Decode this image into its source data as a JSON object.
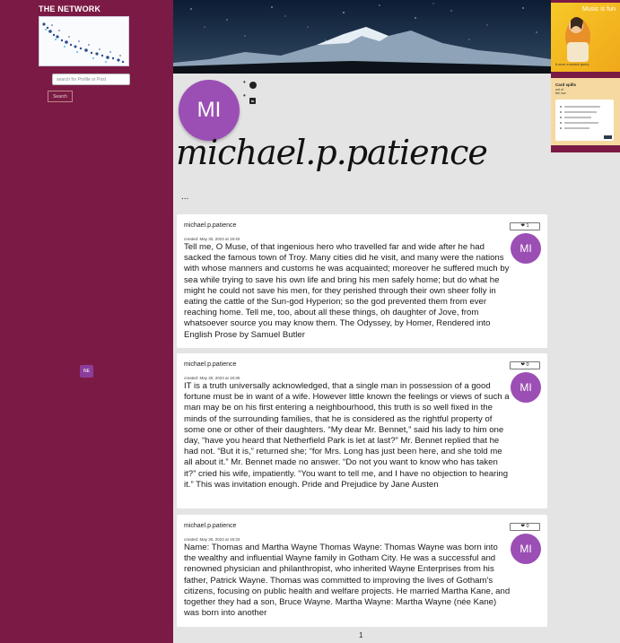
{
  "sidebar": {
    "brand": "THE NETWORK",
    "search_placeholder": "search for Profile or Post",
    "search_button": "Search",
    "badge": "NE"
  },
  "profile": {
    "initials": "MI",
    "username": "michael.p.patience",
    "bio": "...",
    "social": [
      {
        "icon": "github-icon"
      },
      {
        "icon": "linkedin-icon"
      }
    ]
  },
  "posts": [
    {
      "author": "michael.p.patience",
      "created": "created: May 30, 2023 at 19:40",
      "body": "Tell me, O Muse, of that ingenious hero who travelled far and wide after he had sacked the famous town of Troy. Many cities did he visit, and many were the nations with whose manners and customs he was acquainted; moreover he suffered much by sea while trying to save his own life and bring his men safely home; but do what he might he could not save his men, for they perished through their own sheer folly in eating the cattle of the Sun-god Hyperion; so the god prevented them from ever reaching home. Tell me, too, about all these things, oh daughter of Jove, from whatsoever source you may know them. The Odyssey, by Homer, Rendered into English Prose by Samuel Butler",
      "likes": "❤ 1",
      "initials": "MI"
    },
    {
      "author": "michael.p.patience",
      "created": "created: May 30, 2023 at 19:36",
      "body": "IT is a truth universally acknowledged, that a single man in possession of a good fortune must be in want of a wife. However little known the feelings or views of such a man may be on his first entering a neighbourhood, this truth is so well fixed in the minds of the surrounding families, that he is considered as the rightful property of some one or other of their daughters. “My dear Mr. Bennet,” said his lady to him one day, “have you heard that Netherfield Park is let at last?” Mr. Bennet replied that he had not. “But it is,” returned she; “for Mrs. Long has just been here, and she told me all about it.” Mr. Bennet made no answer. “Do not you want to know who has taken it?” cried his wife, impatiently. “You want to tell me, and I have no objection to hearing it.” This was invitation enough. Pride and Prejudice by Jane Austen",
      "likes": "❤ 0",
      "initials": "MI"
    },
    {
      "author": "michael.p.patience",
      "created": "created: May 30, 2023 at 19:33",
      "body": "Name: Thomas and Martha Wayne Thomas Wayne: Thomas Wayne was born into the wealthy and influential Wayne family in Gotham City. He was a successful and renowned physician and philanthropist, who inherited Wayne Enterprises from his father, Patrick Wayne. Thomas was committed to improving the lives of Gotham's citizens, focusing on public health and welfare projects. He married Martha Kane, and together they had a son, Bruce Wayne. Martha Wayne: Martha Wayne (née Kane) was born into another",
      "likes": "❤ 0",
      "initials": "MI"
    }
  ],
  "pagination": {
    "current": "1"
  },
  "ads": {
    "ad1_title": "Music is fun",
    "ad1_sub": "It once a search query",
    "ad2_title": "Card spills",
    "ad2_sub_line1": "out of",
    "ad2_sub_line2": "the row"
  },
  "colors": {
    "sidebar": "#7b1a44",
    "avatar": "#9b4fb4",
    "background": "#e4e4e4"
  }
}
